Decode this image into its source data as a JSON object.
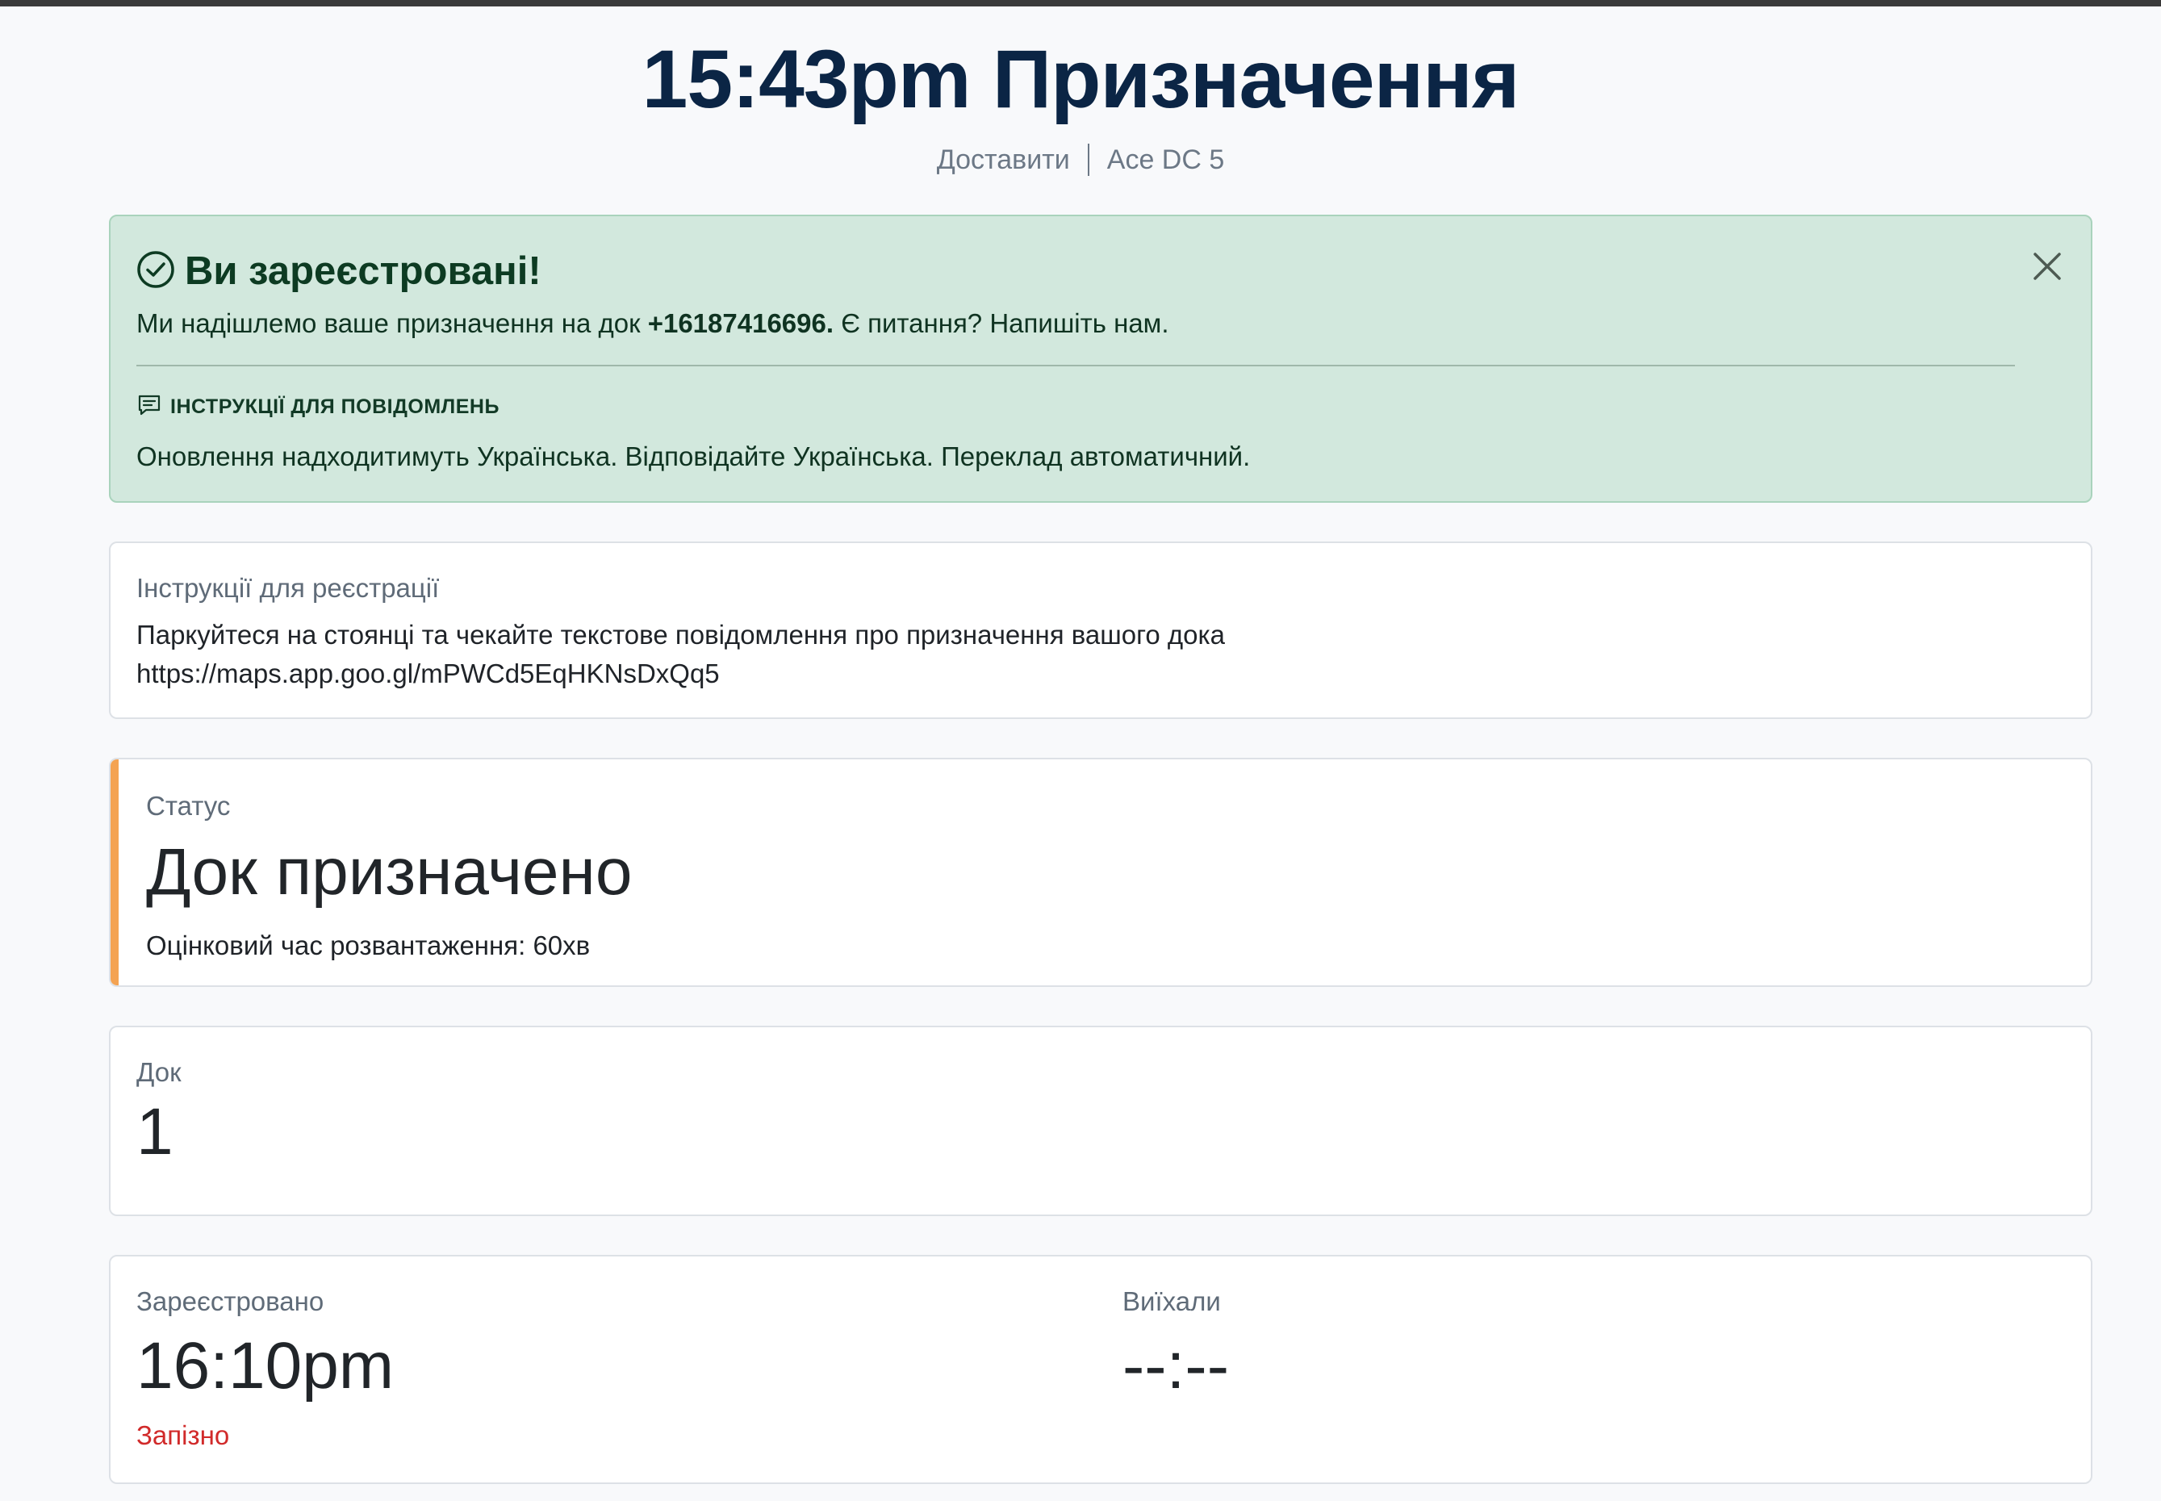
{
  "header": {
    "title": "15:43pm Призначення",
    "type": "Доставити",
    "location": "Ace DC 5"
  },
  "alert": {
    "title": "Ви зареєстровані!",
    "message_prefix": "Ми надішлемо ваше призначення на док",
    "phone": "+16187416696.",
    "message_suffix": "Є питання? Напишіть нам.",
    "messaging_title": "ІНСТРУКЦІЇ ДЛЯ ПОВІДОМЛЕНЬ",
    "messaging_body": "Оновлення надходитимуть Українська. Відповідайте Українська. Переклад автоматичний.",
    "icon": "check-circle-icon",
    "close_icon": "close-icon"
  },
  "registration": {
    "label": "Інструкції для реєстрації",
    "line1": "Паркуйтеся на стоянці та чекайте текстове повідомлення про призначення вашого дока",
    "link": "https://maps.app.goo.gl/mPWCd5EqHKNsDxQq5"
  },
  "status": {
    "label": "Статус",
    "value": "Док призначено",
    "eta": "Оцінковий час розвантаження: 60хв",
    "accent_color": "#f4a352"
  },
  "dock": {
    "label": "Док",
    "value": "1"
  },
  "times": {
    "checked_in_label": "Зареєстровано",
    "checked_in_value": "16:10pm",
    "late_label": "Запізно",
    "departed_label": "Виїхали",
    "departed_value": "--:--"
  },
  "colors": {
    "title": "#0b2545",
    "alert_bg": "#d2e8dd",
    "late": "#d12a2a"
  }
}
